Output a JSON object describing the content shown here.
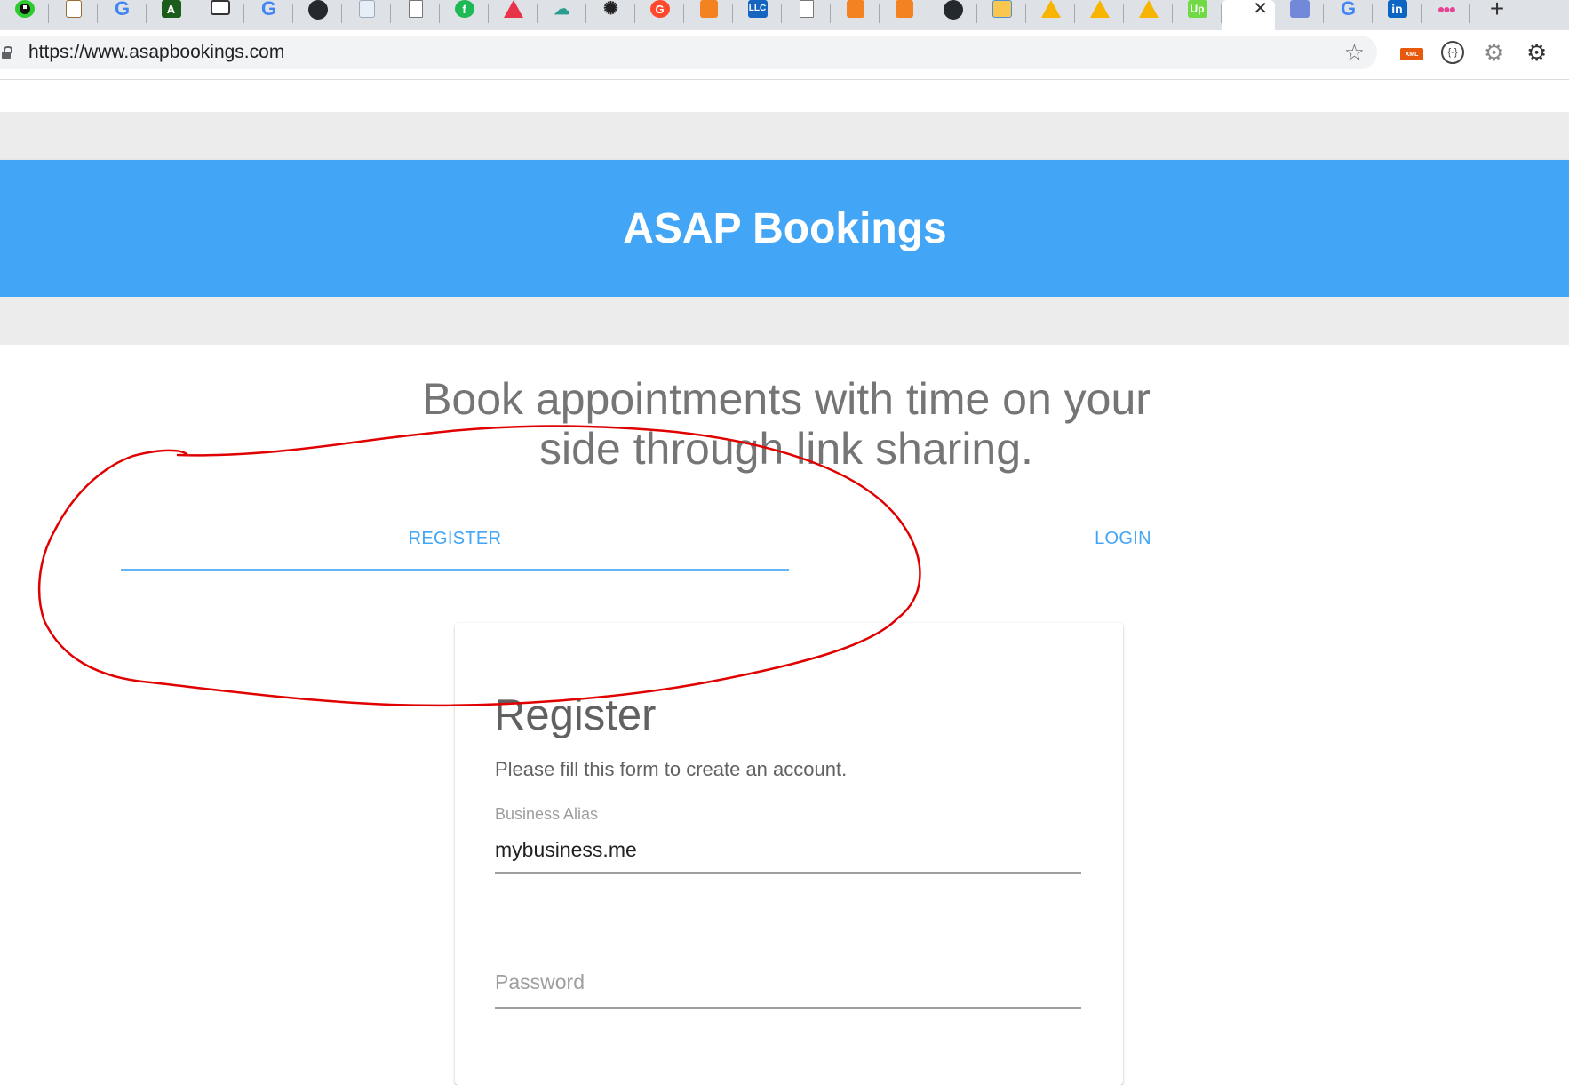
{
  "browser": {
    "tabs": [
      {
        "icon": "pacman-icon"
      },
      {
        "icon": "document-icon"
      },
      {
        "icon": "google-icon",
        "glyph": "G"
      },
      {
        "icon": "android-studio-icon"
      },
      {
        "icon": "id-card-icon"
      },
      {
        "icon": "google-icon",
        "glyph": "G"
      },
      {
        "icon": "github-icon"
      },
      {
        "icon": "sheet-icon"
      },
      {
        "icon": "blank-page-icon"
      },
      {
        "icon": "green-circle-icon"
      },
      {
        "icon": "red-triangle-icon"
      },
      {
        "icon": "cloud-upload-icon"
      },
      {
        "icon": "spinner-icon"
      },
      {
        "icon": "g2-icon"
      },
      {
        "icon": "aws-box-icon"
      },
      {
        "icon": "llc-icon",
        "glyph": "LLC"
      },
      {
        "icon": "blank-page-icon"
      },
      {
        "icon": "aws-box-icon"
      },
      {
        "icon": "aws-box-icon"
      },
      {
        "icon": "github-icon"
      },
      {
        "icon": "book-icon"
      },
      {
        "icon": "warning-triangle-icon"
      },
      {
        "icon": "warning-triangle-icon"
      },
      {
        "icon": "warning-triangle-icon"
      },
      {
        "icon": "upwork-icon",
        "glyph": "Up"
      }
    ],
    "active_tab": {
      "close_glyph": "✕"
    },
    "tabs_after": [
      {
        "icon": "discord-icon"
      },
      {
        "icon": "google-icon",
        "glyph": "G"
      },
      {
        "icon": "linkedin-icon",
        "glyph": "in"
      },
      {
        "icon": "dots-icon"
      }
    ],
    "new_tab_glyph": "+",
    "url": "https://www.asapbookings.com",
    "extensions": [
      {
        "icon": "xml-icon",
        "label": "XML"
      },
      {
        "icon": "code-circle-icon",
        "label": "{-}"
      },
      {
        "icon": "gear-icon"
      },
      {
        "icon": "settings-gear-icon"
      }
    ]
  },
  "page": {
    "hero_title": "ASAP Bookings",
    "hero_color": "#42a5f5",
    "tagline_line1": "Book appointments with time on your",
    "tagline_line2": "side through link sharing.",
    "tabs": {
      "register": "REGISTER",
      "login": "LOGIN",
      "active": "register"
    },
    "card": {
      "title": "Register",
      "subtitle": "Please fill this form to create an account.",
      "alias_label": "Business Alias",
      "alias_value": "mybusiness.me",
      "password_placeholder": "Password"
    }
  },
  "annotation": {
    "color": "#e00000",
    "shape": "freehand-ellipse"
  }
}
